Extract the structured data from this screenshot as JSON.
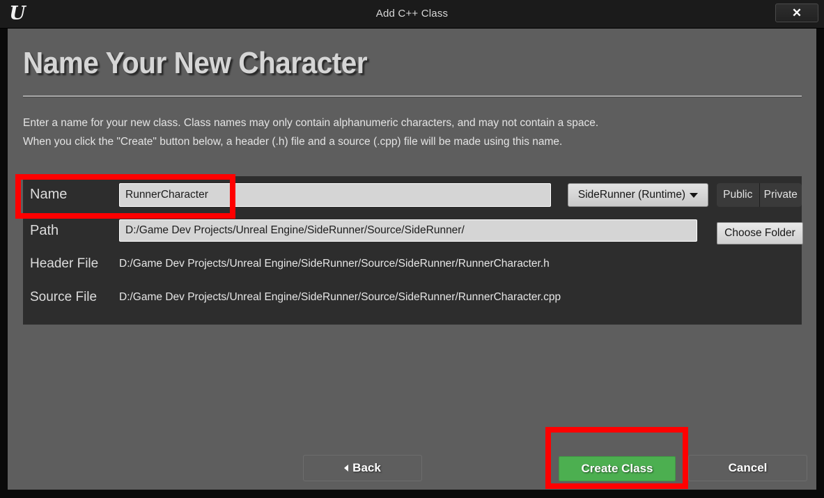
{
  "window": {
    "title": "Add C++ Class",
    "logo_icon": "unreal-engine-logo",
    "close_icon": "✕"
  },
  "heading": "Name Your New Character",
  "description": {
    "line1": "Enter a name for your new class. Class names may only contain alphanumeric characters, and may not contain a space.",
    "line2": "When you click the \"Create\" button below, a header (.h) file and a source (.cpp) file will be made using this name."
  },
  "form": {
    "name": {
      "label": "Name",
      "value": "RunnerCharacter",
      "placeholder": "Name"
    },
    "module": {
      "selected": "SideRunner (Runtime)",
      "caret_icon": "chevron-down-icon"
    },
    "access": {
      "public_label": "Public",
      "private_label": "Private"
    },
    "path": {
      "label": "Path",
      "value": "D:/Game Dev Projects/Unreal Engine/SideRunner/Source/SideRunner/",
      "placeholder": "Path"
    },
    "choose_folder_label": "Choose Folder",
    "header_file": {
      "label": "Header File",
      "value": "D:/Game Dev Projects/Unreal Engine/SideRunner/Source/SideRunner/RunnerCharacter.h"
    },
    "source_file": {
      "label": "Source File",
      "value": "D:/Game Dev Projects/Unreal Engine/SideRunner/Source/SideRunner/RunnerCharacter.cpp"
    }
  },
  "footer": {
    "back_label": "Back",
    "create_label": "Create Class",
    "cancel_label": "Cancel"
  },
  "colors": {
    "accent_green": "#4caf50",
    "annotation_red": "#ff0000",
    "dialog_background": "#5e5e5e",
    "panel_background": "#2d2d2d",
    "titlebar_background": "#1b1b1b"
  }
}
